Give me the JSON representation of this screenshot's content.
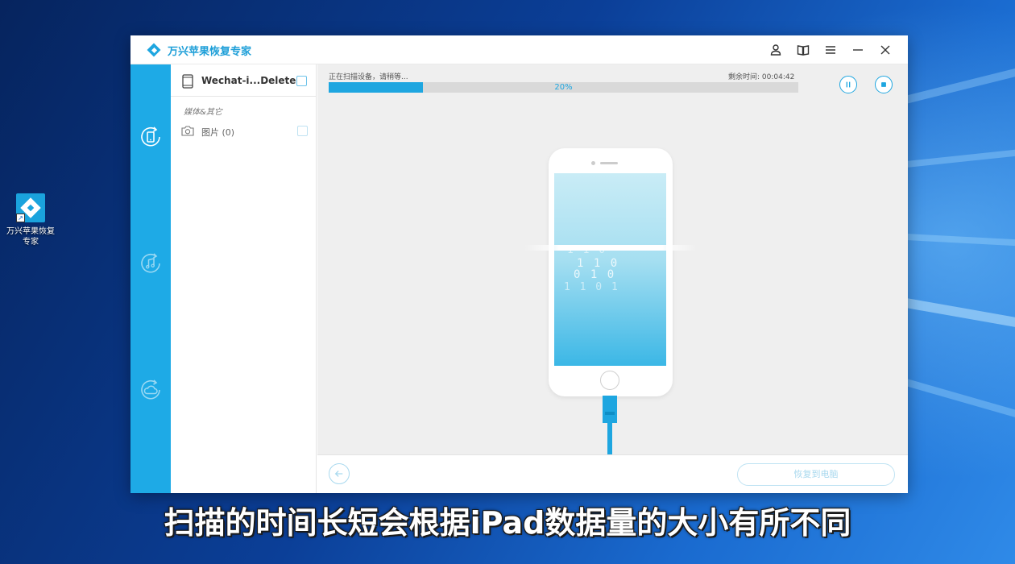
{
  "desktop": {
    "icon_label_line1": "万兴苹果恢复",
    "icon_label_line2": "专家",
    "shortcut_glyph": "↗"
  },
  "window": {
    "title": "万兴苹果恢复专家",
    "controls": [
      "user-icon",
      "book-icon",
      "menu-icon",
      "minimize-icon",
      "close-icon"
    ]
  },
  "rail": {
    "items": [
      "recover-from-device-icon",
      "recover-from-itunes-icon",
      "recover-from-icloud-icon"
    ],
    "active_index": 0
  },
  "categories": {
    "device_label": "Wechat-i...Deleted",
    "section_label": "媒体&其它",
    "photos_label": "图片 (0)"
  },
  "scan": {
    "status": "正在扫描设备，请稍等...",
    "remaining": "剩余时间:  00:04:42",
    "progress_percent": 20,
    "progress_label": "20%"
  },
  "illustration": {
    "binary_rows": [
      "1  1  0",
      "1  1  0",
      "0  1  0",
      "1  1  0  1"
    ]
  },
  "bottom": {
    "recover_label": "恢复到电脑"
  },
  "subtitle": "扫描的时间长短会根据iPad数据量的大小有所不同",
  "colors": {
    "accent": "#1ea6e0",
    "rail": "#1eaae6",
    "progress_track": "#d9d9d9"
  }
}
